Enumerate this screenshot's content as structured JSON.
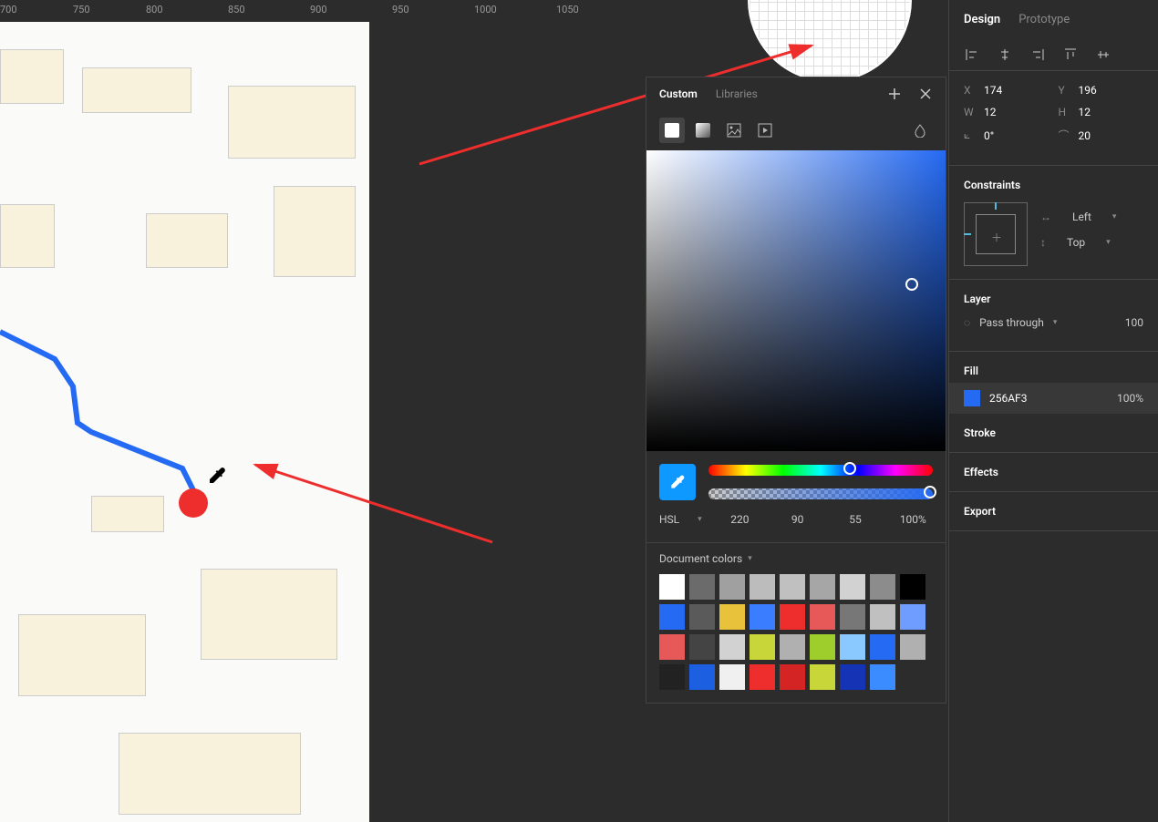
{
  "ruler_ticks": [
    "700",
    "750",
    "800",
    "850",
    "900",
    "950",
    "1000",
    "1050"
  ],
  "color_panel": {
    "tabs": {
      "custom": "Custom",
      "libraries": "Libraries"
    },
    "model": "HSL",
    "values": {
      "h": "220",
      "s": "90",
      "l": "55",
      "a": "100%"
    },
    "doc_label": "Document colors",
    "swatches": [
      "#ffffff",
      "#6b6b6b",
      "#a0a0a0",
      "#bcbcbc",
      "#c0c0c0",
      "#a6a6a6",
      "#d2d2d2",
      "#8c8c8c",
      "#000000",
      "#256AF3",
      "#5a5a5a",
      "#e8c23b",
      "#3a7dff",
      "#ee2d2d",
      "#e75858",
      "#777777",
      "#c0c0c0",
      "#6e9dff",
      "#e75858",
      "#444444",
      "#d2d2d2",
      "#c9d63a",
      "#b0b0b0",
      "#9dce2b",
      "#89c9ff",
      "#256AF3",
      "#b0b0b0",
      "#222222",
      "#1c5fe0",
      "#f0f0f0",
      "#ee2d2d",
      "#d42424",
      "#c9d63a",
      "#1433b5",
      "#3a8cff"
    ]
  },
  "right_panel": {
    "tabs": {
      "design": "Design",
      "prototype": "Prototype"
    },
    "x": "174",
    "y": "196",
    "w": "12",
    "h": "12",
    "rotation": "0°",
    "radius": "20",
    "constraints_label": "Constraints",
    "constraint_h": "Left",
    "constraint_v": "Top",
    "layer_label": "Layer",
    "blend": "Pass through",
    "opacity": "100",
    "fill_label": "Fill",
    "fill_hex": "256AF3",
    "fill_pct": "100%",
    "stroke_label": "Stroke",
    "effects_label": "Effects",
    "export_label": "Export"
  }
}
